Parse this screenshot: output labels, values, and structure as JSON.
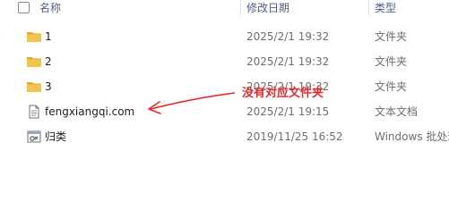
{
  "header": {
    "name_label": "名称",
    "date_label": "修改日期",
    "type_label": "类型"
  },
  "files": [
    {
      "name": "1",
      "date": "2025/2/1 19:32",
      "type": "文件夹",
      "icon": "folder-icon"
    },
    {
      "name": "2",
      "date": "2025/2/1 19:32",
      "type": "文件夹",
      "icon": "folder-icon"
    },
    {
      "name": "3",
      "date": "2025/2/1 19:32",
      "type": "文件夹",
      "icon": "folder-icon"
    },
    {
      "name": "fengxiangqi.com",
      "date": "2025/2/1 19:15",
      "type": "文本文档",
      "icon": "text-document-icon"
    },
    {
      "name": "归类",
      "date": "2019/11/25 16:52",
      "type": "Windows 批处理文件",
      "icon": "batch-file-icon"
    }
  ],
  "annotation": {
    "text": "没有对应文件夹",
    "color": "#e52b2b"
  },
  "colors": {
    "folder": "#f3c44d",
    "folder_dark": "#e2a92a",
    "header_text": "#4d6082"
  }
}
